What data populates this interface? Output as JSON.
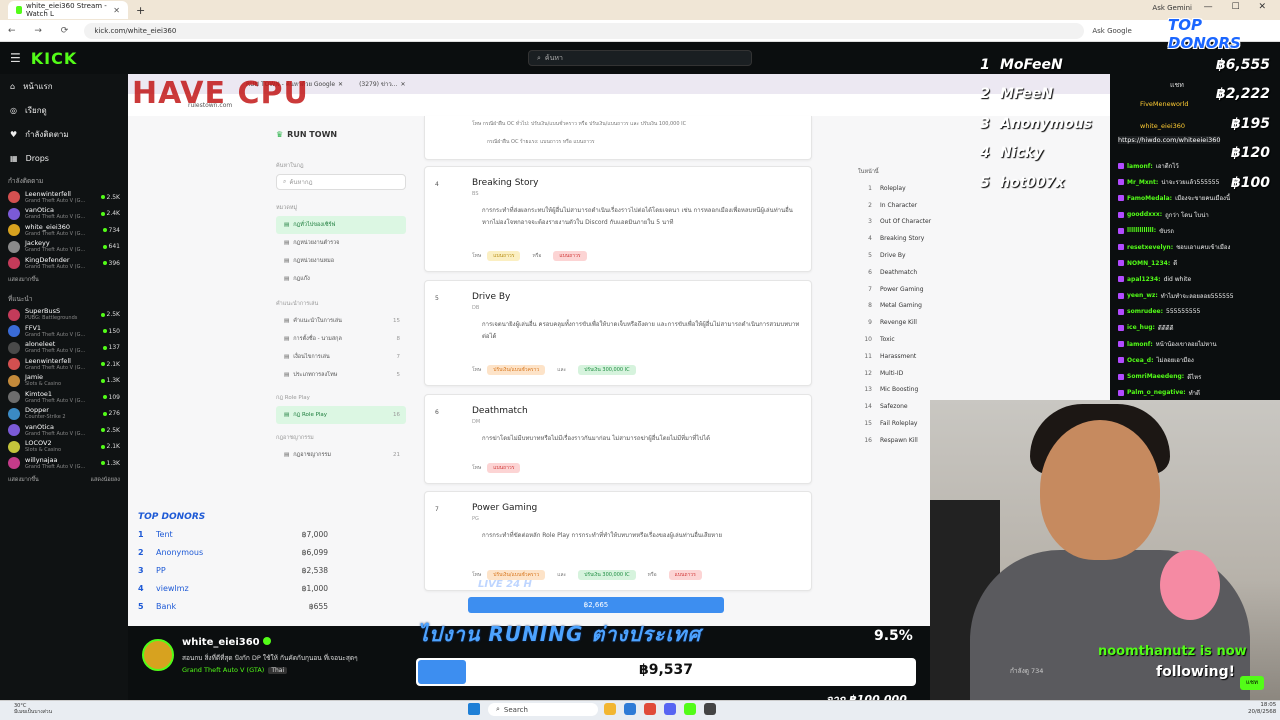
{
  "browser": {
    "tab_title": "white_eiei360 Stream - Watch L",
    "url": "kick.com/white_eiei360",
    "ask_gemini": "Ask Gemini",
    "ask_google": "Ask Google"
  },
  "header": {
    "logo": "KICK",
    "search_placeholder": "ค้นหา"
  },
  "sidebar": {
    "nav": [
      {
        "label": "หน้าแรก"
      },
      {
        "label": "เรียกดู"
      },
      {
        "label": "กำลังติดตาม"
      },
      {
        "label": "Drops"
      }
    ],
    "following_heading": "กำลังติดตาม",
    "following": [
      {
        "name": "Leenwinterfell",
        "game": "Grand Theft Auto V (G...",
        "viewers": "2.5K",
        "color": "#d35050"
      },
      {
        "name": "vanOtica",
        "game": "Grand Theft Auto V (G...",
        "viewers": "2.4K",
        "color": "#7b5ad6"
      },
      {
        "name": "white_eiei360",
        "game": "Grand Theft Auto V (G...",
        "viewers": "734",
        "color": "#d7a21f"
      },
      {
        "name": "Jackeyy",
        "game": "Grand Theft Auto V (G...",
        "viewers": "641",
        "color": "#8a8a8a"
      },
      {
        "name": "KingDefender",
        "game": "Grand Theft Auto V (G...",
        "viewers": "396",
        "color": "#c43b5a"
      }
    ],
    "show_more_1": "แสดงมากขึ้น",
    "recommended_heading": "ที่แนะนำ",
    "recommended": [
      {
        "name": "SuperBusS",
        "game": "PUBG: Battlegrounds",
        "viewers": "2.5K",
        "color": "#c43b5a"
      },
      {
        "name": "FFV1",
        "game": "Grand Theft Auto V (G...",
        "viewers": "150",
        "color": "#3a6bd6"
      },
      {
        "name": "aloneleet",
        "game": "Grand Theft Auto V (G...",
        "viewers": "137",
        "color": "#4a4a4a"
      },
      {
        "name": "Leenwinterfell",
        "game": "Grand Theft Auto V (G...",
        "viewers": "2.1K",
        "color": "#d35050"
      },
      {
        "name": "Jamie",
        "game": "Slots & Casino",
        "viewers": "1.3K",
        "color": "#c48a3b"
      },
      {
        "name": "Kimtoe1",
        "game": "Grand Theft Auto V (G...",
        "viewers": "109",
        "color": "#6d6d6d"
      },
      {
        "name": "Dopper",
        "game": "Counter-Strike 2",
        "viewers": "276",
        "color": "#3b8ac4"
      },
      {
        "name": "vanOtica",
        "game": "Grand Theft Auto V (G...",
        "viewers": "2.5K",
        "color": "#7b5ad6"
      },
      {
        "name": "LOCOV2",
        "game": "Slots & Casino",
        "viewers": "2.1K",
        "color": "#c4c43b"
      },
      {
        "name": "willynajaa",
        "game": "Grand Theft Auto V (G...",
        "viewers": "1.3K",
        "color": "#c43b8a"
      }
    ],
    "show_more_2": "แสดงมากขึ้น",
    "show_less": "แสดงน้อยลง"
  },
  "stream_page": {
    "inner_tab1": "RUN TOWN - ค้นหาด้วย Google",
    "inner_tab2": "(3279) ข่าว...",
    "watermark": "HAVE CPU",
    "site_title": "RUN TOWN",
    "search_label": "ค้นหาในกฎ",
    "search_placeholder": "ค้นหากฎ",
    "category_label": "หมวดหมู่",
    "left_items": [
      {
        "label": "กฎทั่วไปของเซิร์ฟ",
        "count": "",
        "active": true
      },
      {
        "label": "กฎหน่วยงานตำรวจ",
        "count": "",
        "active": false
      },
      {
        "label": "กฎหน่วยงานหมอ",
        "count": "",
        "active": false
      },
      {
        "label": "กฎแก๊ง",
        "count": "",
        "active": false
      }
    ],
    "left_label_2": "คำแนะนำการเล่น",
    "left_items_2": [
      {
        "label": "คำแนะนำในการเล่น",
        "count": "15",
        "active": false
      },
      {
        "label": "การตั้งชื่อ - นามสกุล",
        "count": "8",
        "active": false
      },
      {
        "label": "เงื่อนไขการเล่น",
        "count": "7",
        "active": false
      },
      {
        "label": "ประเภทการลงโทษ",
        "count": "5",
        "active": false
      }
    ],
    "left_label_3": "กฎ Role Play",
    "left_items_3": [
      {
        "label": "กฎ Role Play",
        "count": "16",
        "active": true
      }
    ],
    "left_label_4": "กฎอาชญากรรม",
    "left_items_4": [
      {
        "label": "กฎอาชญากรรม",
        "count": "21",
        "active": false
      }
    ],
    "prev_card_line1": "โทษ  กรณีฝ่าฝืน OC ทั่วไป:  ปรับเงิน/แบนชั่วคราว  หรือ  ปรับเงิน/แบนถาวร  และ  ปรับเงิน 100,000 IC",
    "prev_card_line2": "กรณีฝ่าฝืน OC ร้ายแรง:  แบนถาวร  หรือ  แบนถาวร",
    "rules": [
      {
        "num": "4",
        "title": "Breaking Story",
        "abbr": "BS",
        "desc": "การกระทำที่ส่งผลกระทบให้ผู้อื่นไม่สามารถดำเนินเรื่องราวไปต่อได้โดยเจตนา เช่น การหลอกเมืองเพื่อหลบหนีผู้เล่นท่านอื่น หากไม่องโจทกอาจจะต้องรายงานตัวใน Discord กับแอดมินภายใน 5 นาที",
        "tags": [
          "แบนถาวร",
          "หรือ",
          "แบนถาวร"
        ]
      },
      {
        "num": "5",
        "title": "Drive By",
        "abbr": "DB",
        "desc": "การเจตนายิงผู้เล่นอื่น ครอบคลุมทั้งการขับเพื่อให้บาดเจ็บหรือถึงตาย และการขับเพื่อให้ผู้อื่นไม่สามารถดำเนินการสวมบทบาทต่อได้",
        "tags": [
          "ปรับเงิน/แบนชั่วคราว",
          "และ",
          "ปรับเงิน 300,000 IC"
        ]
      },
      {
        "num": "6",
        "title": "Deathmatch",
        "abbr": "DM",
        "desc": "การฆ่าโดยไม่มีบทบาทหรือไม่มีเรื่องราวกันมาก่อน ไม่สามารถฆ่าผู้อื่นโดยไม่มีที่มาที่ไปได้",
        "tags": [
          "แบนถาวร"
        ]
      },
      {
        "num": "7",
        "title": "Power Gaming",
        "abbr": "PG",
        "desc": "การกระทำที่ขัดต่อหลัก Role Play การกระทำที่ทำให้บทบาทหรือเรื่องของผู้เล่นท่านอื่นเสียหาย",
        "tags": [
          "ปรับเงิน/แบนชั่วคราว",
          "และ",
          "ปรับเงิน 300,000 IC",
          "หรือ",
          "แบนถาวร"
        ]
      }
    ],
    "penalty_label": "โทษ",
    "toc_heading": "ในหน้านี้",
    "toc": [
      {
        "n": "1",
        "label": "Roleplay"
      },
      {
        "n": "2",
        "label": "In Character"
      },
      {
        "n": "3",
        "label": "Out Of Character"
      },
      {
        "n": "4",
        "label": "Breaking Story"
      },
      {
        "n": "5",
        "label": "Drive By"
      },
      {
        "n": "6",
        "label": "Deathmatch"
      },
      {
        "n": "7",
        "label": "Power Gaming"
      },
      {
        "n": "8",
        "label": "Metal Gaming"
      },
      {
        "n": "9",
        "label": "Revenge Kill"
      },
      {
        "n": "10",
        "label": "Toxic"
      },
      {
        "n": "11",
        "label": "Harassment"
      },
      {
        "n": "12",
        "label": "Multi-ID"
      },
      {
        "n": "13",
        "label": "Mic Boosting"
      },
      {
        "n": "14",
        "label": "Safezone"
      },
      {
        "n": "15",
        "label": "Fail Roleplay"
      },
      {
        "n": "16",
        "label": "Respawn Kill"
      }
    ]
  },
  "overlay": {
    "live24": "LIVE 24 H",
    "mini_amount": "฿2,665",
    "runing_text": "ไปงาน RUNING ต่างประเทศ",
    "donation_amount": "฿9,537",
    "donation_progress_pct": 9.5,
    "pct_label": "9.5%",
    "goal_text": "จาก ฿100,000",
    "top_donors_left_heading": "TOP DONORS",
    "top_donors_left": [
      {
        "rank": "1",
        "name": "Tent",
        "amount": "฿7,000"
      },
      {
        "rank": "2",
        "name": "Anonymous",
        "amount": "฿6,099"
      },
      {
        "rank": "3",
        "name": "PP",
        "amount": "฿2,538"
      },
      {
        "rank": "4",
        "name": "viewlmz",
        "amount": "฿1,000"
      },
      {
        "rank": "5",
        "name": "Bank",
        "amount": "฿655"
      }
    ],
    "top_donors_right_heading": "TOP DONORS",
    "top_donors_right": [
      {
        "rank": "1",
        "name": "MoFeeN",
        "amount": "฿6,555"
      },
      {
        "rank": "2",
        "name": "MFeeN",
        "amount": "฿2,222"
      },
      {
        "rank": "3",
        "name": "Anonymous",
        "amount": "฿195"
      },
      {
        "rank": "4",
        "name": "Nicky",
        "amount": "฿120"
      },
      {
        "rank": "5",
        "name": "hot007x",
        "amount": "฿100"
      }
    ],
    "follow_name": "noomthanutz is now",
    "follow_text": "following!"
  },
  "chat": {
    "header_label": "แชท",
    "fivemeneworld": "FiveMeneworld",
    "pinned_user": "white_eiei360",
    "pinned_link": "https://hiwdo.com/whiteeiei360",
    "messages": [
      {
        "user": "lamonf:",
        "text": "เอาดีกไว้"
      },
      {
        "user": "Mr_Mxnt:",
        "text": "น่าจะรวยแล้ว555555"
      },
      {
        "user": "FamoMedala:",
        "text": "เมืองจะขายคนเมืองนี้"
      },
      {
        "user": "gooddxxx:",
        "text": "ถูกว่า โดน โบน่า"
      },
      {
        "user": "lllllllllllll:",
        "text": "ขับรถ"
      },
      {
        "user": "resetxevelyn:",
        "text": "ชอบเอาแคบเข้าเมือง"
      },
      {
        "user": "NOMN_1234:",
        "text": "ดี"
      },
      {
        "user": "apal1234:",
        "text": "did white"
      },
      {
        "user": "yeen_wz:",
        "text": "ทำไมทำจะลอยลอย555555"
      },
      {
        "user": "somrudee:",
        "text": "555555555"
      },
      {
        "user": "ice_hug:",
        "text": "ดีดีดีดี"
      },
      {
        "user": "lamonf:",
        "text": "หน้าน้องเขาลอยไม่หาน"
      },
      {
        "user": "Ocea_d:",
        "text": "ไม่ลอยเอามือง"
      },
      {
        "user": "SomriMaeedeng:",
        "text": "ดีไหร"
      },
      {
        "user": "Palm_o_negative:",
        "text": "ทำดี"
      }
    ],
    "viewer_info": "กำลังดู 734",
    "chat_button": "แชท"
  },
  "streamer": {
    "name": "white_eiei360",
    "title": "สอนกบ สิ่งที่ดีที่สุด ปังกัก DP ใช้ให้ กันคัดกับกุนอน ที่เจอนะสุดๆ",
    "game": "Grand Theft Auto V (GTA)",
    "lang": "Thai"
  },
  "taskbar": {
    "weather_temp": "30°C",
    "weather_desc": "มีเมฆเป็นบางส่วน",
    "search_label": "Search",
    "time": "18:05",
    "date": "20/8/2568"
  }
}
